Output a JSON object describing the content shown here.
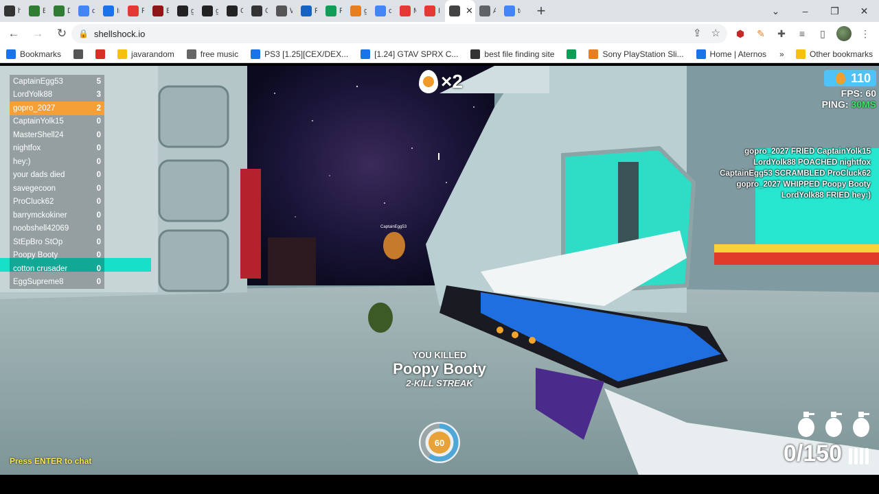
{
  "browser": {
    "tabs": [
      {
        "title": "hc",
        "fav_color": "#333333",
        "icon": "skull-icon"
      },
      {
        "title": "Bu",
        "fav_color": "#2e7d32",
        "icon": "green-square-icon"
      },
      {
        "title": "Dc",
        "fav_color": "#2e7d32",
        "icon": "green-square-icon"
      },
      {
        "title": "de",
        "fav_color": "#4285f4",
        "icon": "google-icon"
      },
      {
        "title": "Im",
        "fav_color": "#1a73e8",
        "icon": "chart-icon"
      },
      {
        "title": "Ru",
        "fav_color": "#e53935",
        "icon": "youtube-icon"
      },
      {
        "title": "Be",
        "fav_color": "#8e1616",
        "icon": "m-icon"
      },
      {
        "title": "gc",
        "fav_color": "#222222",
        "icon": "github-icon"
      },
      {
        "title": "gc",
        "fav_color": "#222222",
        "icon": "github-icon"
      },
      {
        "title": "Cl",
        "fav_color": "#222222",
        "icon": "github-icon"
      },
      {
        "title": "Oj",
        "fav_color": "#333333",
        "icon": "openai-icon"
      },
      {
        "title": "W",
        "fav_color": "#555555",
        "icon": "globe-icon"
      },
      {
        "title": "Re",
        "fav_color": "#1565c0",
        "icon": "dot-icon"
      },
      {
        "title": "Py",
        "fav_color": "#0f9d58",
        "icon": "w-icon"
      },
      {
        "title": "gil",
        "fav_color": "#e67e22",
        "icon": "hand-icon"
      },
      {
        "title": "ca",
        "fav_color": "#4285f4",
        "icon": "google-icon"
      },
      {
        "title": "M",
        "fav_color": "#e53935",
        "icon": "youtube-icon"
      },
      {
        "title": "I t",
        "fav_color": "#e53935",
        "icon": "youtube-icon"
      },
      {
        "title": "",
        "fav_color": "#444444",
        "icon": "speaker-icon",
        "active": true
      },
      {
        "title": "A",
        "fav_color": "#5f6368",
        "icon": "doc-icon"
      },
      {
        "title": "te",
        "fav_color": "#4285f4",
        "icon": "google-icon"
      }
    ],
    "url": "shellshock.io",
    "bookmarks": [
      {
        "label": "Bookmarks",
        "icon": "star-icon",
        "color": "#1a73e8"
      },
      {
        "label": "",
        "icon": "chrome-icon",
        "color": "#555555"
      },
      {
        "label": "",
        "icon": "heart-icon",
        "color": "#d93025"
      },
      {
        "label": "javarandom",
        "icon": "folder-icon",
        "color": "#f4c20d"
      },
      {
        "label": "free music",
        "icon": "alien-icon",
        "color": "#666666"
      },
      {
        "label": "PS3 [1.25][CEX/DEX...",
        "icon": "c-icon",
        "color": "#1a73e8"
      },
      {
        "label": "[1.24] GTAV SPRX C...",
        "icon": "c-icon",
        "color": "#1a73e8"
      },
      {
        "label": "best file finding site",
        "icon": "camera-icon",
        "color": "#333333"
      },
      {
        "label": "",
        "icon": "sheet-icon",
        "color": "#0f9d58"
      },
      {
        "label": "Sony PlayStation Sli...",
        "icon": "bag-icon",
        "color": "#e67e22"
      },
      {
        "label": "Home | Aternos",
        "icon": "grid-icon",
        "color": "#1a73e8"
      }
    ],
    "other_bookmarks": "Other bookmarks",
    "more_glyph": "»"
  },
  "game": {
    "leaderboard": [
      {
        "name": "CaptainEgg53",
        "score": "5",
        "me": false
      },
      {
        "name": "LordYolk88",
        "score": "3",
        "me": false
      },
      {
        "name": "gopro_2027",
        "score": "2",
        "me": true
      },
      {
        "name": "CaptainYolk15",
        "score": "0",
        "me": false
      },
      {
        "name": "MasterShell24",
        "score": "0",
        "me": false
      },
      {
        "name": "nightfox",
        "score": "0",
        "me": false
      },
      {
        "name": "hey:)",
        "score": "0",
        "me": false
      },
      {
        "name": "your dads died",
        "score": "0",
        "me": false
      },
      {
        "name": "savegecoon",
        "score": "0",
        "me": false
      },
      {
        "name": "ProCluck62",
        "score": "0",
        "me": false
      },
      {
        "name": "barrymckokiner",
        "score": "0",
        "me": false
      },
      {
        "name": "noobshell42069",
        "score": "0",
        "me": false
      },
      {
        "name": "StEpBro StOp",
        "score": "0",
        "me": false
      },
      {
        "name": "Poopy Booty",
        "score": "0",
        "me": false
      },
      {
        "name": "cotton crusader",
        "score": "0",
        "me": false
      },
      {
        "name": "EggSupreme8",
        "score": "0",
        "me": false
      }
    ],
    "kill_counter": "×2",
    "egg_count": "110",
    "fps_label": "FPS: 60",
    "ping_label": "PING: ",
    "ping_value": "30MS",
    "ping_color": "#3fe06a",
    "killfeed": [
      "gopro_2027 FRIED CaptainYolk15",
      "LordYolk88 POACHED nightfox",
      "CaptainEgg53 SCRAMBLED ProCluck62",
      "gopro_2027 WHIPPED Poopy Booty",
      "LordYolk88 FRIED hey:)"
    ],
    "kill_message": {
      "header": "YOU KILLED",
      "victim": "Poopy Booty",
      "streak": "2-KILL STREAK"
    },
    "health": {
      "value": "60",
      "fraction": 0.6
    },
    "grenade_count": 3,
    "ammo": "0/150",
    "chat_hint": "Press ENTER to chat",
    "enemy_nametag": "CaptainEgg53",
    "accent_color": "#f5a037"
  }
}
